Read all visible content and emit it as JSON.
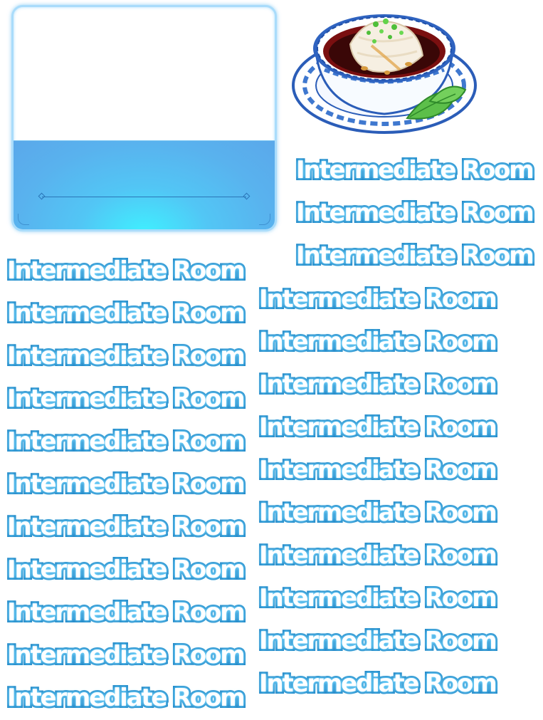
{
  "labels": {
    "top_right": [
      "Intermediate Room",
      "Intermediate Room",
      "Intermediate Room"
    ],
    "left_column": [
      "Intermediate Room",
      "Intermediate Room",
      "Intermediate Room",
      "Intermediate Room",
      "Intermediate Room",
      "Intermediate Room",
      "Intermediate Room",
      "Intermediate Room",
      "Intermediate Room",
      "Intermediate Room",
      "Intermediate Room"
    ],
    "right_column": [
      "Intermediate Room",
      "Intermediate Room",
      "Intermediate Room",
      "Intermediate Room",
      "Intermediate Room",
      "Intermediate Room",
      "Intermediate Room",
      "Intermediate Room",
      "Intermediate Room",
      "Intermediate Room"
    ]
  },
  "colors": {
    "text_fill": "#ffffff",
    "text_stroke": "#1f86c7",
    "glow": "#3ff0ff",
    "panel_blue": "#59b2ee"
  },
  "icons": [
    "food-bowl-icon"
  ]
}
